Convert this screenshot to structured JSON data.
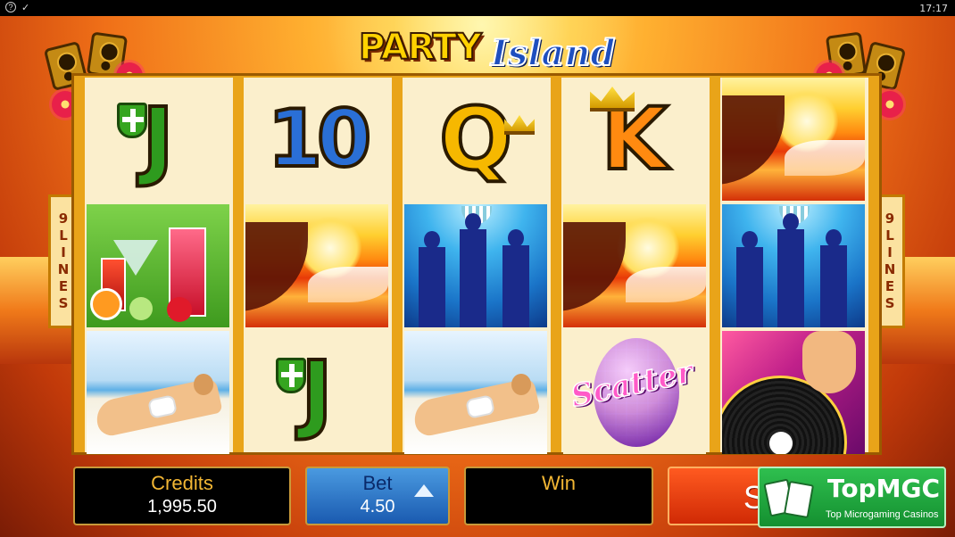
{
  "status": {
    "time": "17:17"
  },
  "title": {
    "part1": "PARTY",
    "part2": "Island"
  },
  "paylines": {
    "left": [
      "9",
      "L",
      "I",
      "N",
      "E",
      "S"
    ],
    "right": [
      "9",
      "L",
      "I",
      "N",
      "E",
      "S"
    ]
  },
  "reels": [
    [
      {
        "symbol": "J",
        "icon": "shield-icon"
      },
      {
        "symbol": "cocktails"
      },
      {
        "symbol": "beach-girl"
      }
    ],
    [
      {
        "symbol": "10"
      },
      {
        "symbol": "sunset"
      },
      {
        "symbol": "J",
        "icon": "shield-icon"
      }
    ],
    [
      {
        "symbol": "Q",
        "icon": "crown-icon"
      },
      {
        "symbol": "dancers"
      },
      {
        "symbol": "beach-girl"
      }
    ],
    [
      {
        "symbol": "K",
        "icon": "crown-icon"
      },
      {
        "symbol": "sunset"
      },
      {
        "symbol": "scatter",
        "text": "Scatter"
      }
    ],
    [
      {
        "symbol": "sunset"
      },
      {
        "symbol": "dancers"
      },
      {
        "symbol": "vinyl-dj"
      }
    ]
  ],
  "panel": {
    "credits_label": "Credits",
    "credits_value": "1,995.50",
    "bet_label": "Bet",
    "bet_value": "4.50",
    "win_label": "Win",
    "spin_label": "Spin"
  },
  "badge": {
    "brand": "TopMGC",
    "tagline": "Top Microgaming Casinos"
  },
  "colors": {
    "credits_label": "#f2b634",
    "spin": "#e8400f",
    "bet": "#2a72c8",
    "badge": "#22a840"
  }
}
